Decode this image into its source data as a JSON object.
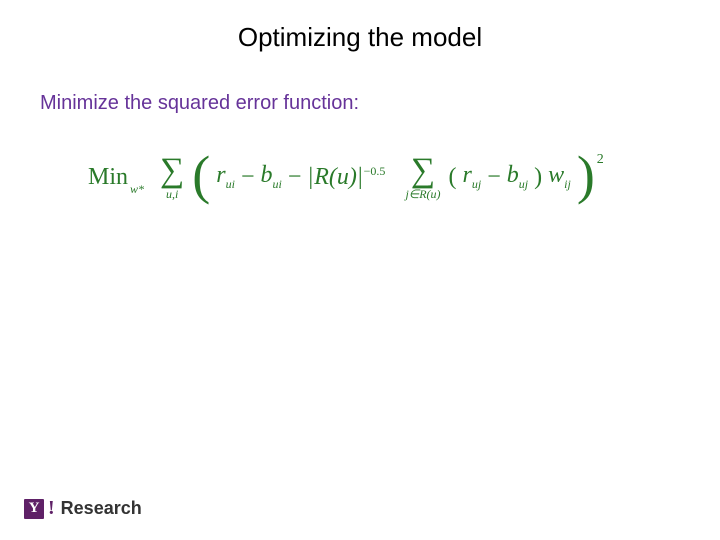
{
  "title": "Optimizing the model",
  "subtitle": "Minimize the squared error function:",
  "formula": {
    "min": "Min",
    "min_sub": "w*",
    "sum1_under": "u,i",
    "term_r": "r",
    "term_r_sub": "ui",
    "minus": "−",
    "term_b": "b",
    "term_b_sub": "ui",
    "abs_l": "|",
    "abs_content": "R(u)",
    "abs_r": "|",
    "exp1": "−0.5",
    "sum2_sub": "j∈R(u)",
    "paren_l": "(",
    "term_rj": "r",
    "term_rj_sub": "uj",
    "term_bj": "b",
    "term_bj_sub": "uj",
    "paren_r": ")",
    "term_w": "w",
    "term_w_sub": "ij",
    "outer_exp": "2"
  },
  "footer": {
    "y": "Y",
    "bang": "!",
    "label": "Research"
  }
}
